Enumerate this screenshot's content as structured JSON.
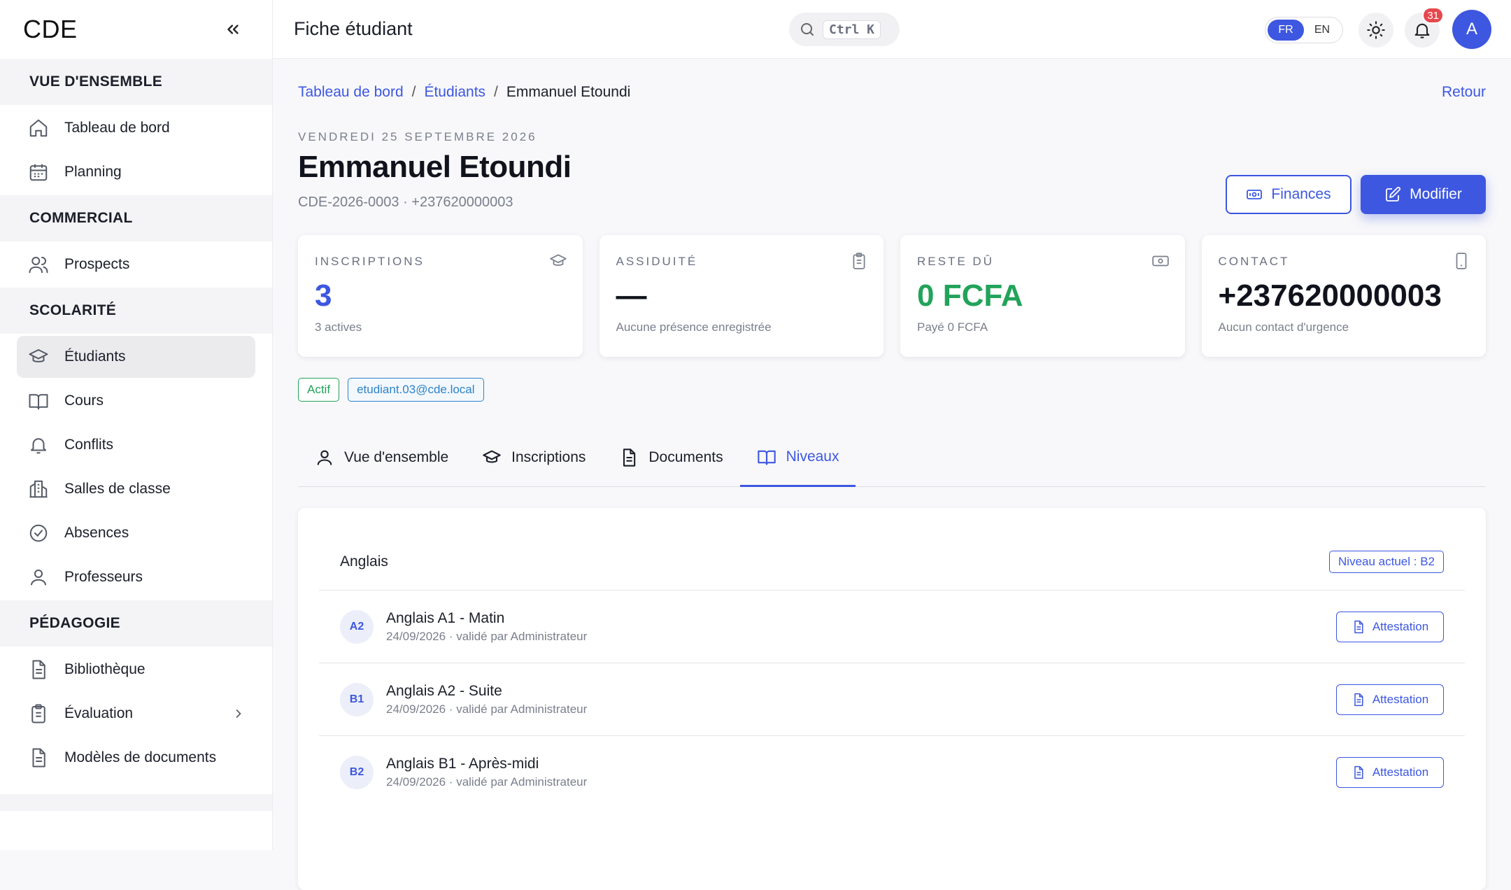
{
  "sidebar": {
    "brand": "CDE",
    "sections": [
      {
        "title": "VUE D'ENSEMBLE",
        "items": [
          {
            "label": "Tableau de bord",
            "icon": "home-icon"
          },
          {
            "label": "Planning",
            "icon": "calendar-icon"
          }
        ]
      },
      {
        "title": "COMMERCIAL",
        "items": [
          {
            "label": "Prospects",
            "icon": "users-icon"
          }
        ]
      },
      {
        "title": "SCOLARITÉ",
        "items": [
          {
            "label": "Étudiants",
            "icon": "graduation-cap-icon",
            "active": true
          },
          {
            "label": "Cours",
            "icon": "book-icon"
          },
          {
            "label": "Conflits",
            "icon": "bell-icon"
          },
          {
            "label": "Salles de classe",
            "icon": "building-icon"
          },
          {
            "label": "Absences",
            "icon": "check-circle-icon"
          },
          {
            "label": "Professeurs",
            "icon": "user-icon"
          }
        ]
      },
      {
        "title": "PÉDAGOGIE",
        "items": [
          {
            "label": "Bibliothèque",
            "icon": "file-icon"
          },
          {
            "label": "Évaluation",
            "icon": "clipboard-icon",
            "chevron": true
          },
          {
            "label": "Modèles de documents",
            "icon": "file-icon"
          }
        ]
      }
    ]
  },
  "topbar": {
    "title": "Fiche étudiant",
    "search_shortcut": "Ctrl K",
    "lang_fr": "FR",
    "lang_en": "EN",
    "notifications": "31",
    "avatar_initial": "A"
  },
  "breadcrumb": {
    "home": "Tableau de bord",
    "students": "Étudiants",
    "current": "Emmanuel Etoundi",
    "sep": "/"
  },
  "header": {
    "back": "Retour",
    "date": "VENDREDI 25 SEPTEMBRE 2026",
    "name": "Emmanuel Etoundi",
    "subtitle": "CDE-2026-0003 · +237620000003",
    "finances_label": "Finances",
    "edit_label": "Modifier"
  },
  "cards": {
    "inscriptions": {
      "label": "INSCRIPTIONS",
      "value": "3",
      "note": "3 actives"
    },
    "assiduite": {
      "label": "ASSIDUITÉ",
      "value": "—",
      "note": "Aucune présence enregistrée"
    },
    "reste": {
      "label": "RESTE DÛ",
      "value": "0 FCFA",
      "note": "Payé 0 FCFA"
    },
    "contact": {
      "label": "CONTACT",
      "value": "+237620000003",
      "note": "Aucun contact d'urgence"
    }
  },
  "tags": {
    "status": "Actif",
    "email": "etudiant.03@cde.local"
  },
  "tabs": {
    "overview": "Vue d'ensemble",
    "inscriptions": "Inscriptions",
    "documents": "Documents",
    "niveaux": "Niveaux"
  },
  "panel": {
    "title": "Anglais",
    "current_level": "Niveau actuel : B2",
    "rows": [
      {
        "level": "A2",
        "title": "Anglais A1 - Matin",
        "meta": "24/09/2026 · validé par Administrateur",
        "action": "Attestation"
      },
      {
        "level": "B1",
        "title": "Anglais A2 - Suite",
        "meta": "24/09/2026 · validé par Administrateur",
        "action": "Attestation"
      },
      {
        "level": "B2",
        "title": "Anglais B1 - Après-midi",
        "meta": "24/09/2026 · validé par Administrateur",
        "action": "Attestation"
      }
    ]
  },
  "colors": {
    "accent": "#3d57e0",
    "success": "#22a35a",
    "danger": "#e5484d",
    "info": "#2d83c8"
  }
}
